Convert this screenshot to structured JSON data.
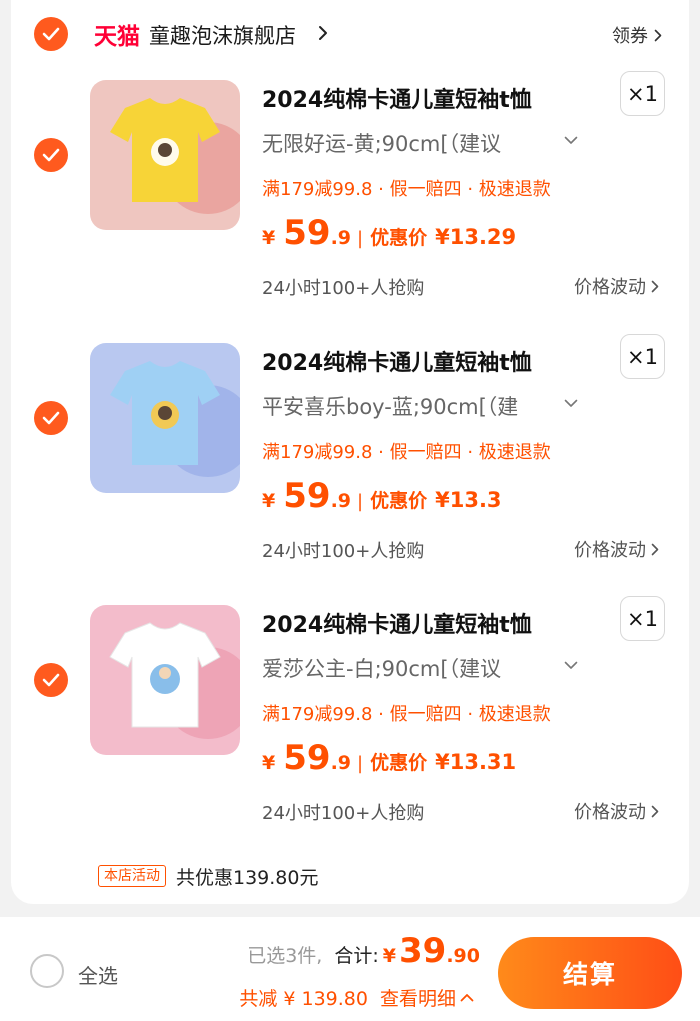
{
  "shop": {
    "logo": "天猫",
    "name": "童趣泡沫旗舰店",
    "coupon_label": "领券"
  },
  "items": [
    {
      "title": "2024纯棉卡通儿童短袖t恤",
      "quantity": "×1",
      "sku": "无限好运-黄;90cm[（建议",
      "promo": "满179减99.8 · 假一赔四 · 极速退款",
      "currency": "¥",
      "price_int": "59",
      "price_dec": ".9",
      "discount_label": "优惠价",
      "discount_price": "¥13.29",
      "hot": "24小时100+人抢购",
      "trend_label": "价格波动",
      "shirt_color": "#f7d437",
      "bg_color": "#efc6c0"
    },
    {
      "title": "2024纯棉卡通儿童短袖t恤",
      "quantity": "×1",
      "sku": "平安喜乐boy-蓝;90cm[（建",
      "promo": "满179减99.8 · 假一赔四 · 极速退款",
      "currency": "¥",
      "price_int": "59",
      "price_dec": ".9",
      "discount_label": "优惠价",
      "discount_price": "¥13.3",
      "hot": "24小时100+人抢购",
      "trend_label": "价格波动",
      "shirt_color": "#9fd0f4",
      "bg_color": "#b9c8f0"
    },
    {
      "title": "2024纯棉卡通儿童短袖t恤",
      "quantity": "×1",
      "sku": "爱莎公主-白;90cm[（建议",
      "promo": "满179减99.8 · 假一赔四 · 极速退款",
      "currency": "¥",
      "price_int": "59",
      "price_dec": ".9",
      "discount_label": "优惠价",
      "discount_price": "¥13.31",
      "hot": "24小时100+人抢购",
      "trend_label": "价格波动",
      "shirt_color": "#ffffff",
      "bg_color": "#f3bccb"
    }
  ],
  "activity": {
    "tag": "本店活动",
    "text": "共优惠139.80元"
  },
  "footer": {
    "select_all_label": "全选",
    "selected_count": "已选3件,",
    "total_label": "合计:",
    "total_currency": "¥",
    "total_int": "39",
    "total_dec": ".90",
    "saving_text": "共减 ¥ 139.80",
    "details_label": "查看明细",
    "checkout_label": "结算"
  },
  "colors": {
    "accent": "#ff5000",
    "check": "#ff5a1e",
    "tmall": "#ff0036"
  }
}
